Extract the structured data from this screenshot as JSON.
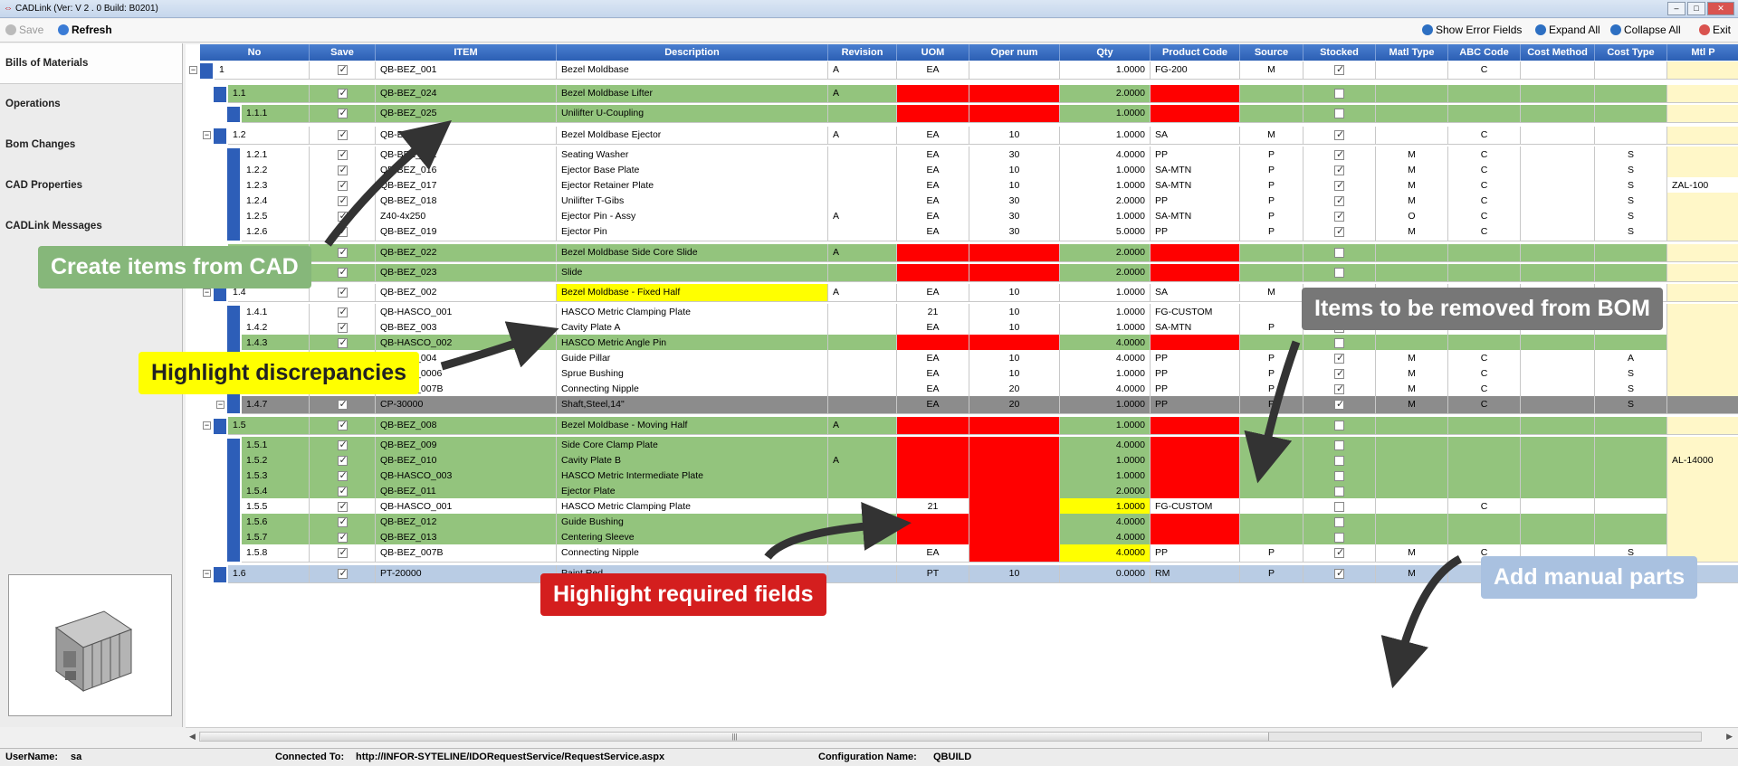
{
  "window": {
    "title": "CADLink  (Ver:  V 2 . 0 Build:  B0201)"
  },
  "toolbar": {
    "save": "Save",
    "refresh": "Refresh",
    "show_error_fields": "Show Error Fields",
    "expand_all": "Expand All",
    "collapse_all": "Collapse All",
    "exit": "Exit"
  },
  "nav": {
    "items": [
      "Bills of Materials",
      "Operations",
      "Bom Changes",
      "CAD Properties",
      "CADLink Messages"
    ]
  },
  "grid": {
    "columns": [
      "No",
      "Save",
      "ITEM",
      "Description",
      "Revision",
      "UOM",
      "Oper num",
      "Qty",
      "Product Code",
      "Source",
      "Stocked",
      "Matl Type",
      "ABC Code",
      "Cost Method",
      "Cost Type",
      "Mtl P"
    ],
    "rows": [
      {
        "no": "1",
        "save": true,
        "item": "QB-BEZ_001",
        "desc": "Bezel Moldbase",
        "rev": "A",
        "uom": "EA",
        "oper": "",
        "qty": "1.0000",
        "prod": "FG-200",
        "source": "M",
        "stocked": true,
        "matl": "",
        "abc": "C",
        "costm": "",
        "costt": "",
        "mtl": ""
      },
      {
        "no": "1.1",
        "save": true,
        "item": "QB-BEZ_024",
        "desc": "Bezel Moldbase Lifter",
        "rev": "A",
        "uom": "",
        "oper": "",
        "qty": "2.0000",
        "prod": "",
        "source": "",
        "stocked": false,
        "matl": "",
        "abc": "",
        "costm": "",
        "costt": "",
        "mtl": ""
      },
      {
        "no": "1.1.1",
        "save": true,
        "item": "QB-BEZ_025",
        "desc": "Unilifter U-Coupling",
        "rev": "",
        "uom": "",
        "oper": "",
        "qty": "1.0000",
        "prod": "",
        "source": "",
        "stocked": false,
        "matl": "",
        "abc": "",
        "costm": "",
        "costt": "",
        "mtl": ""
      },
      {
        "no": "1.2",
        "save": true,
        "item": "QB-BEZ_015",
        "desc": "Bezel Moldbase Ejector",
        "rev": "A",
        "uom": "EA",
        "oper": "10",
        "qty": "1.0000",
        "prod": "SA",
        "source": "M",
        "stocked": true,
        "matl": "",
        "abc": "C",
        "costm": "",
        "costt": "",
        "mtl": ""
      },
      {
        "no": "1.2.1",
        "save": true,
        "item": "QB-BEZ_021",
        "desc": "Seating Washer",
        "rev": "",
        "uom": "EA",
        "oper": "30",
        "qty": "4.0000",
        "prod": "PP",
        "source": "P",
        "stocked": true,
        "matl": "M",
        "abc": "C",
        "costm": "",
        "costt": "S",
        "mtl": ""
      },
      {
        "no": "1.2.2",
        "save": true,
        "item": "QB-BEZ_016",
        "desc": "Ejector Base Plate",
        "rev": "",
        "uom": "EA",
        "oper": "10",
        "qty": "1.0000",
        "prod": "SA-MTN",
        "source": "P",
        "stocked": true,
        "matl": "M",
        "abc": "C",
        "costm": "",
        "costt": "S",
        "mtl": ""
      },
      {
        "no": "1.2.3",
        "save": true,
        "item": "QB-BEZ_017",
        "desc": "Ejector Retainer Plate",
        "rev": "",
        "uom": "EA",
        "oper": "10",
        "qty": "1.0000",
        "prod": "SA-MTN",
        "source": "P",
        "stocked": true,
        "matl": "M",
        "abc": "C",
        "costm": "",
        "costt": "S",
        "mtl": "ZAL-100"
      },
      {
        "no": "1.2.4",
        "save": true,
        "item": "QB-BEZ_018",
        "desc": "Unilifter T-Gibs",
        "rev": "",
        "uom": "EA",
        "oper": "30",
        "qty": "2.0000",
        "prod": "PP",
        "source": "P",
        "stocked": true,
        "matl": "M",
        "abc": "C",
        "costm": "",
        "costt": "S",
        "mtl": ""
      },
      {
        "no": "1.2.5",
        "save": true,
        "item": "Z40-4x250",
        "desc": "Ejector Pin - Assy",
        "rev": "A",
        "uom": "EA",
        "oper": "30",
        "qty": "1.0000",
        "prod": "SA-MTN",
        "source": "P",
        "stocked": true,
        "matl": "O",
        "abc": "C",
        "costm": "",
        "costt": "S",
        "mtl": ""
      },
      {
        "no": "1.2.6",
        "save": true,
        "item": "QB-BEZ_019",
        "desc": "Ejector Pin",
        "rev": "",
        "uom": "EA",
        "oper": "30",
        "qty": "5.0000",
        "prod": "PP",
        "source": "P",
        "stocked": true,
        "matl": "M",
        "abc": "C",
        "costm": "",
        "costt": "S",
        "mtl": ""
      },
      {
        "no": "1.3",
        "save": true,
        "item": "QB-BEZ_022",
        "desc": "Bezel Moldbase Side Core Slide",
        "rev": "A",
        "uom": "",
        "oper": "",
        "qty": "2.0000",
        "prod": "",
        "source": "",
        "stocked": false,
        "matl": "",
        "abc": "",
        "costm": "",
        "costt": "",
        "mtl": ""
      },
      {
        "no": "1.3.1",
        "save": true,
        "item": "QB-BEZ_023",
        "desc": "Slide",
        "rev": "",
        "uom": "",
        "oper": "",
        "qty": "2.0000",
        "prod": "",
        "source": "",
        "stocked": false,
        "matl": "",
        "abc": "",
        "costm": "",
        "costt": "",
        "mtl": ""
      },
      {
        "no": "1.4",
        "save": true,
        "item": "QB-BEZ_002",
        "desc": "Bezel Moldbase - Fixed Half",
        "rev": "A",
        "uom": "EA",
        "oper": "10",
        "qty": "1.0000",
        "prod": "SA",
        "source": "M",
        "stocked": true,
        "matl": "",
        "abc": "C",
        "costm": "",
        "costt": "",
        "mtl": ""
      },
      {
        "no": "1.4.1",
        "save": true,
        "item": "QB-HASCO_001",
        "desc": "HASCO Metric Clamping Plate",
        "rev": "",
        "uom": "21",
        "oper": "10",
        "qty": "1.0000",
        "prod": "FG-CUSTOM",
        "source": "",
        "stocked": false,
        "matl": "",
        "abc": "C",
        "costm": "",
        "costt": "",
        "mtl": ""
      },
      {
        "no": "1.4.2",
        "save": true,
        "item": "QB-BEZ_003",
        "desc": "Cavity Plate A",
        "rev": "",
        "uom": "EA",
        "oper": "10",
        "qty": "1.0000",
        "prod": "SA-MTN",
        "source": "P",
        "stocked": true,
        "matl": "M",
        "abc": "C",
        "costm": "",
        "costt": "S",
        "mtl": ""
      },
      {
        "no": "1.4.3",
        "save": true,
        "item": "QB-HASCO_002",
        "desc": "HASCO Metric Angle Pin",
        "rev": "",
        "uom": "",
        "oper": "",
        "qty": "4.0000",
        "prod": "",
        "source": "",
        "stocked": false,
        "matl": "",
        "abc": "",
        "costm": "",
        "costt": "",
        "mtl": ""
      },
      {
        "no": "1.4.4",
        "save": true,
        "item": "QB-BEZ_004",
        "desc": "Guide Pillar",
        "rev": "",
        "uom": "EA",
        "oper": "10",
        "qty": "4.0000",
        "prod": "PP",
        "source": "P",
        "stocked": true,
        "matl": "M",
        "abc": "C",
        "costm": "",
        "costt": "A",
        "mtl": ""
      },
      {
        "no": "1.4.5",
        "save": true,
        "item": "QB-BEZ_0006",
        "desc": "Sprue Bushing",
        "rev": "",
        "uom": "EA",
        "oper": "10",
        "qty": "1.0000",
        "prod": "PP",
        "source": "P",
        "stocked": true,
        "matl": "M",
        "abc": "C",
        "costm": "",
        "costt": "S",
        "mtl": ""
      },
      {
        "no": "1.4.6",
        "save": true,
        "item": "QB-BEZ_007B",
        "desc": "Connecting Nipple",
        "rev": "",
        "uom": "EA",
        "oper": "20",
        "qty": "4.0000",
        "prod": "PP",
        "source": "P",
        "stocked": true,
        "matl": "M",
        "abc": "C",
        "costm": "",
        "costt": "S",
        "mtl": ""
      },
      {
        "no": "1.4.7",
        "save": true,
        "item": "CP-30000",
        "desc": "Shaft,Steel,14\"",
        "rev": "",
        "uom": "EA",
        "oper": "20",
        "qty": "1.0000",
        "prod": "PP",
        "source": "P",
        "stocked": true,
        "matl": "M",
        "abc": "C",
        "costm": "",
        "costt": "S",
        "mtl": ""
      },
      {
        "no": "1.5",
        "save": true,
        "item": "QB-BEZ_008",
        "desc": "Bezel Moldbase - Moving Half",
        "rev": "A",
        "uom": "",
        "oper": "",
        "qty": "1.0000",
        "prod": "",
        "source": "",
        "stocked": false,
        "matl": "",
        "abc": "",
        "costm": "",
        "costt": "",
        "mtl": ""
      },
      {
        "no": "1.5.1",
        "save": true,
        "item": "QB-BEZ_009",
        "desc": "Side Core Clamp Plate",
        "rev": "",
        "uom": "",
        "oper": "",
        "qty": "4.0000",
        "prod": "",
        "source": "",
        "stocked": false,
        "matl": "",
        "abc": "",
        "costm": "",
        "costt": "",
        "mtl": ""
      },
      {
        "no": "1.5.2",
        "save": true,
        "item": "QB-BEZ_010",
        "desc": "Cavity Plate B",
        "rev": "A",
        "uom": "",
        "oper": "",
        "qty": "1.0000",
        "prod": "",
        "source": "",
        "stocked": false,
        "matl": "",
        "abc": "",
        "costm": "",
        "costt": "",
        "mtl": "AL-14000"
      },
      {
        "no": "1.5.3",
        "save": true,
        "item": "QB-HASCO_003",
        "desc": "HASCO Metric Intermediate Plate",
        "rev": "",
        "uom": "",
        "oper": "",
        "qty": "1.0000",
        "prod": "",
        "source": "",
        "stocked": false,
        "matl": "",
        "abc": "",
        "costm": "",
        "costt": "",
        "mtl": ""
      },
      {
        "no": "1.5.4",
        "save": true,
        "item": "QB-BEZ_011",
        "desc": "Ejector Plate",
        "rev": "",
        "uom": "",
        "oper": "",
        "qty": "2.0000",
        "prod": "",
        "source": "",
        "stocked": false,
        "matl": "",
        "abc": "",
        "costm": "",
        "costt": "",
        "mtl": ""
      },
      {
        "no": "1.5.5",
        "save": true,
        "item": "QB-HASCO_001",
        "desc": "HASCO Metric Clamping Plate",
        "rev": "",
        "uom": "21",
        "oper": "",
        "qty": "1.0000",
        "prod": "FG-CUSTOM",
        "source": "",
        "stocked": false,
        "matl": "",
        "abc": "C",
        "costm": "",
        "costt": "",
        "mtl": ""
      },
      {
        "no": "1.5.6",
        "save": true,
        "item": "QB-BEZ_012",
        "desc": "Guide Bushing",
        "rev": "",
        "uom": "",
        "oper": "",
        "qty": "4.0000",
        "prod": "",
        "source": "",
        "stocked": false,
        "matl": "",
        "abc": "",
        "costm": "",
        "costt": "",
        "mtl": ""
      },
      {
        "no": "1.5.7",
        "save": true,
        "item": "QB-BEZ_013",
        "desc": "Centering Sleeve",
        "rev": "",
        "uom": "",
        "oper": "",
        "qty": "4.0000",
        "prod": "",
        "source": "",
        "stocked": false,
        "matl": "",
        "abc": "",
        "costm": "",
        "costt": "",
        "mtl": ""
      },
      {
        "no": "1.5.8",
        "save": true,
        "item": "QB-BEZ_007B",
        "desc": "Connecting Nipple",
        "rev": "",
        "uom": "EA",
        "oper": "",
        "qty": "4.0000",
        "prod": "PP",
        "source": "P",
        "stocked": true,
        "matl": "M",
        "abc": "C",
        "costm": "",
        "costt": "S",
        "mtl": ""
      },
      {
        "no": "1.6",
        "save": true,
        "item": "PT-20000",
        "desc": "Paint,Red",
        "rev": "",
        "uom": "PT",
        "oper": "10",
        "qty": "0.0000",
        "prod": "RM",
        "source": "P",
        "stocked": true,
        "matl": "M",
        "abc": "C",
        "costm": "",
        "costt": "S",
        "mtl": ""
      }
    ]
  },
  "callouts": {
    "create": "Create items from CAD",
    "discrepancies": "Highlight discrepancies",
    "required": "Highlight required fields",
    "removed": "Items to be removed from BOM",
    "manual": "Add manual parts"
  },
  "status": {
    "user_label": "UserName:",
    "user": "sa",
    "conn_label": "Connected To:",
    "conn": "http://INFOR-SYTELINE/IDORequestService/RequestService.aspx",
    "cfg_label": "Configuration Name:",
    "cfg": "QBUILD"
  },
  "colors": {
    "header": "#2c5fb4",
    "green": "#93c47d",
    "red": "#ff0000",
    "yellow": "#ffff00",
    "gray": "#8c8c8c",
    "blue": "#b9cce4"
  }
}
